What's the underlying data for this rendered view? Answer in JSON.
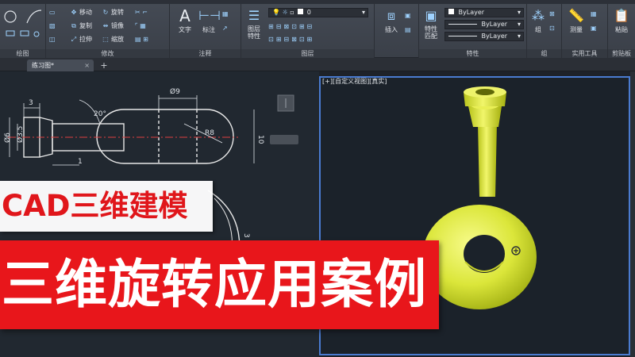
{
  "ribbon": {
    "panels": {
      "draw": "绘图",
      "modify": "修改",
      "annotate": "注释",
      "layers": "图层",
      "properties": "特性",
      "groups": "组",
      "utilities": "实用工具",
      "clipboard": "剪贴板"
    },
    "modify_tools": [
      "移动",
      "旋转",
      "复制",
      "镜像",
      "拉伸",
      "缩放"
    ],
    "big_tools": {
      "text": "文字",
      "dimension": "标注",
      "layer_properties": "图层\n特性",
      "insert": "插入",
      "match_properties": "特性\n匹配",
      "group": "组",
      "measure": "测量",
      "paste": "粘贴"
    },
    "bylayer": [
      "ByLayer",
      "ByLayer",
      "ByLayer"
    ],
    "layer_name": "0"
  },
  "tabs": {
    "document": "练习图*",
    "new_tab": "+"
  },
  "viewport": {
    "label": "[+][自定义视图][真实]"
  },
  "drawing": {
    "dims": [
      "Ø9",
      "3",
      "20°",
      "Ø6",
      "Ø3.5",
      "R8",
      "10",
      "1",
      "3"
    ]
  },
  "banners": {
    "line1": "CAD三维建模",
    "line2": "三维旋转应用案例"
  },
  "colors": {
    "banner_red": "#e8161b",
    "model_yellow": "#e6f04a",
    "viewport_border": "#4a7bd0",
    "sketch_white": "#e8e8e8"
  }
}
